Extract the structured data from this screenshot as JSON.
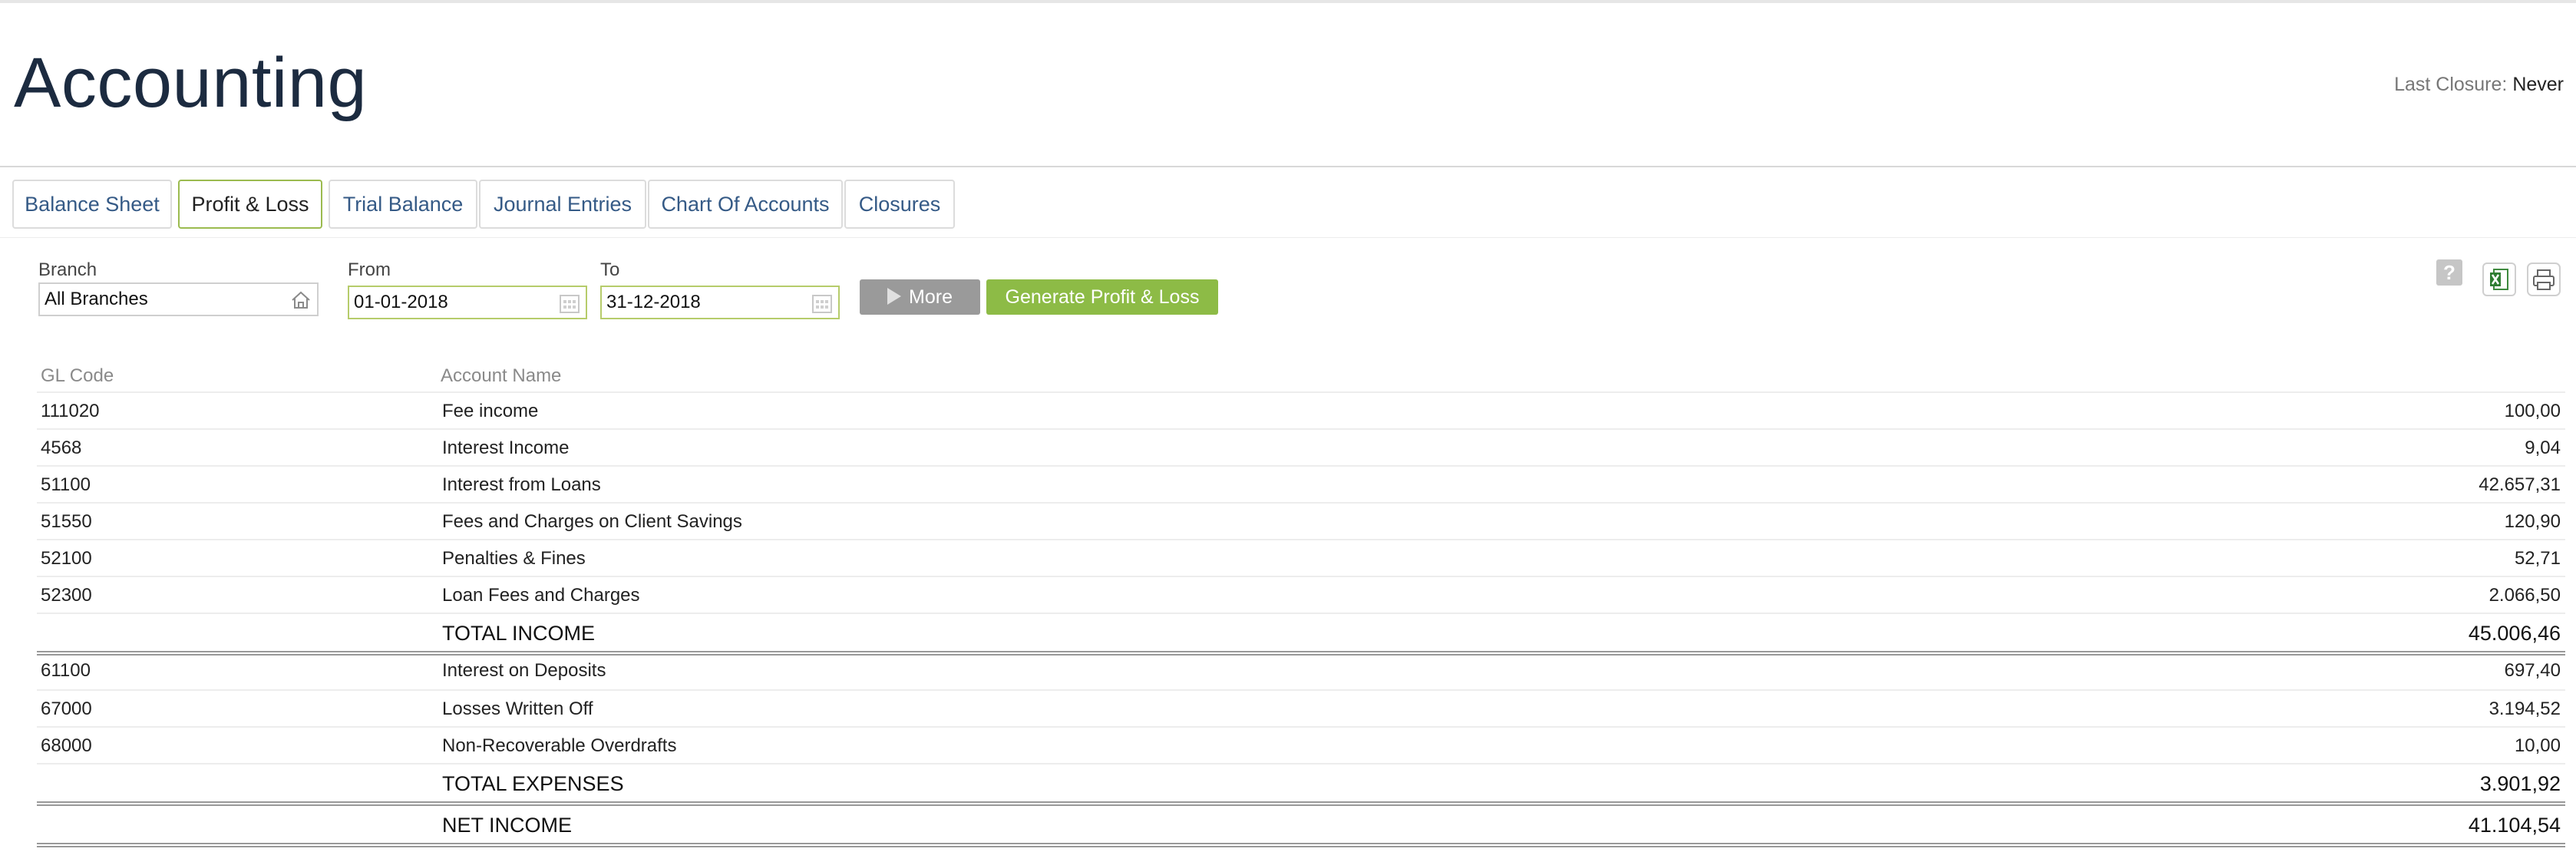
{
  "header": {
    "title": "Accounting",
    "last_closure_label": "Last Closure:",
    "last_closure_value": "Never"
  },
  "tabs": [
    {
      "label": "Balance Sheet",
      "active": false
    },
    {
      "label": "Profit & Loss",
      "active": true
    },
    {
      "label": "Trial Balance",
      "active": false
    },
    {
      "label": "Journal Entries",
      "active": false
    },
    {
      "label": "Chart Of Accounts",
      "active": false
    },
    {
      "label": "Closures",
      "active": false
    }
  ],
  "filters": {
    "branch_label": "Branch",
    "branch_value": "All Branches",
    "from_label": "From",
    "from_value": "01-01-2018",
    "to_label": "To",
    "to_value": "31-12-2018",
    "more_label": "More",
    "generate_label": "Generate Profit & Loss"
  },
  "toolbar": {
    "help_symbol": "?"
  },
  "table": {
    "headers": {
      "gl_code": "GL Code",
      "account_name": "Account Name"
    },
    "income_rows": [
      {
        "code": "111020",
        "name": "Fee income",
        "value": "100,00"
      },
      {
        "code": "4568",
        "name": "Interest Income",
        "value": "9,04"
      },
      {
        "code": "51100",
        "name": "Interest from Loans",
        "value": "42.657,31"
      },
      {
        "code": "51550",
        "name": "Fees and Charges on Client Savings",
        "value": "120,90"
      },
      {
        "code": "52100",
        "name": "Penalties & Fines",
        "value": "52,71"
      },
      {
        "code": "52300",
        "name": "Loan Fees and Charges",
        "value": "2.066,50"
      }
    ],
    "total_income": {
      "label": "TOTAL INCOME",
      "value": "45.006,46"
    },
    "expense_rows": [
      {
        "code": "61100",
        "name": "Interest on Deposits",
        "value": "697,40"
      },
      {
        "code": "67000",
        "name": "Losses Written Off",
        "value": "3.194,52"
      },
      {
        "code": "68000",
        "name": "Non-Recoverable Overdrafts",
        "value": "10,00"
      }
    ],
    "total_expenses": {
      "label": "TOTAL EXPENSES",
      "value": "3.901,92"
    },
    "net_income": {
      "label": "NET INCOME",
      "value": "41.104,54"
    }
  },
  "colors": {
    "title": "#1c2b40",
    "tab_text": "#355a86",
    "tab_active_border": "#9bbb4f",
    "generate_button": "#8dbb46",
    "more_button": "#9a9a9a"
  }
}
